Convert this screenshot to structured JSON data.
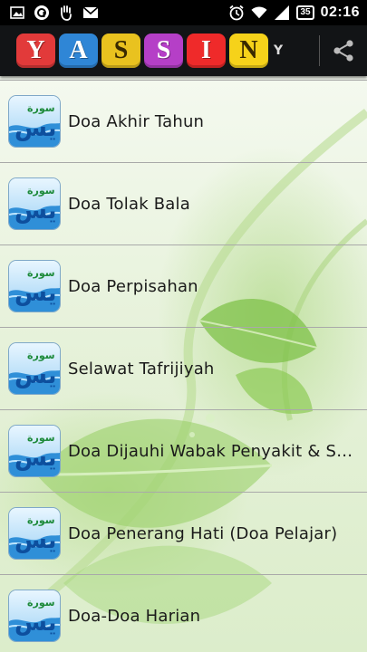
{
  "status_bar": {
    "time": "02:16",
    "battery": "35",
    "left_icons": [
      "image-icon",
      "browser-icon",
      "hand-icon",
      "email-icon"
    ],
    "right_icons": [
      "alarm-icon",
      "wifi-icon",
      "signal-icon",
      "battery-icon"
    ]
  },
  "app_bar": {
    "logo_letters": [
      "Y",
      "A",
      "S",
      "S",
      "I",
      "N"
    ],
    "logo_colors": [
      "#e23a3a",
      "#2f86d6",
      "#e9c21f",
      "#b53fc7",
      "#ef2a2a",
      "#f6d21a"
    ],
    "overflow_mark": "Y",
    "share_icon": "share-icon"
  },
  "items": [
    {
      "label": "Doa Akhir Tahun"
    },
    {
      "label": "Doa Tolak Bala"
    },
    {
      "label": "Doa Perpisahan"
    },
    {
      "label": "Selawat Tafrijiyah"
    },
    {
      "label": "Doa Dijauhi Wabak Penyakit & S…"
    },
    {
      "label": "Doa Penerang Hati (Doa Pelajar)"
    },
    {
      "label": "Doa-Doa Harian"
    }
  ],
  "item_icon": "surah-yasin-icon"
}
